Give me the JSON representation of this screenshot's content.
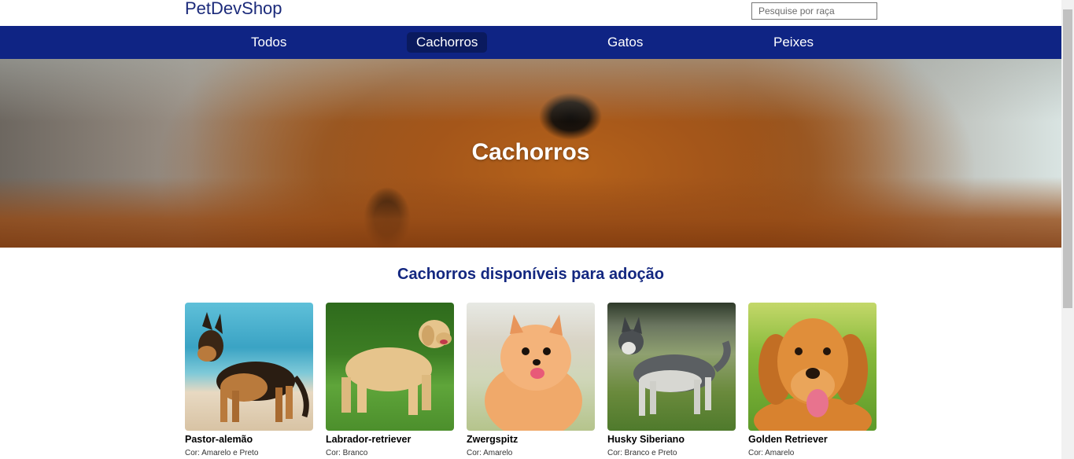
{
  "header": {
    "logo": "PetDevShop",
    "search_placeholder": "Pesquise por raça"
  },
  "nav": {
    "items": [
      {
        "label": "Todos",
        "active": false
      },
      {
        "label": "Cachorros",
        "active": true
      },
      {
        "label": "Gatos",
        "active": false
      },
      {
        "label": "Peixes",
        "active": false
      }
    ]
  },
  "hero": {
    "title": "Cachorros"
  },
  "section": {
    "title": "Cachorros disponíveis para adoção"
  },
  "cards": [
    {
      "name": "Pastor-alemão",
      "color": "Cor: Amarelo e Preto"
    },
    {
      "name": "Labrador-retriever",
      "color": "Cor: Branco"
    },
    {
      "name": "Zwergspitz",
      "color": "Cor: Amarelo"
    },
    {
      "name": "Husky Siberiano",
      "color": "Cor: Branco e Preto"
    },
    {
      "name": "Golden Retriever",
      "color": "Cor: Amarelo"
    }
  ],
  "colors": {
    "nav_bg": "#0f2484",
    "nav_active_bg": "#0a1a5e",
    "logo": "#1b2a7a",
    "section_title": "#132780"
  }
}
